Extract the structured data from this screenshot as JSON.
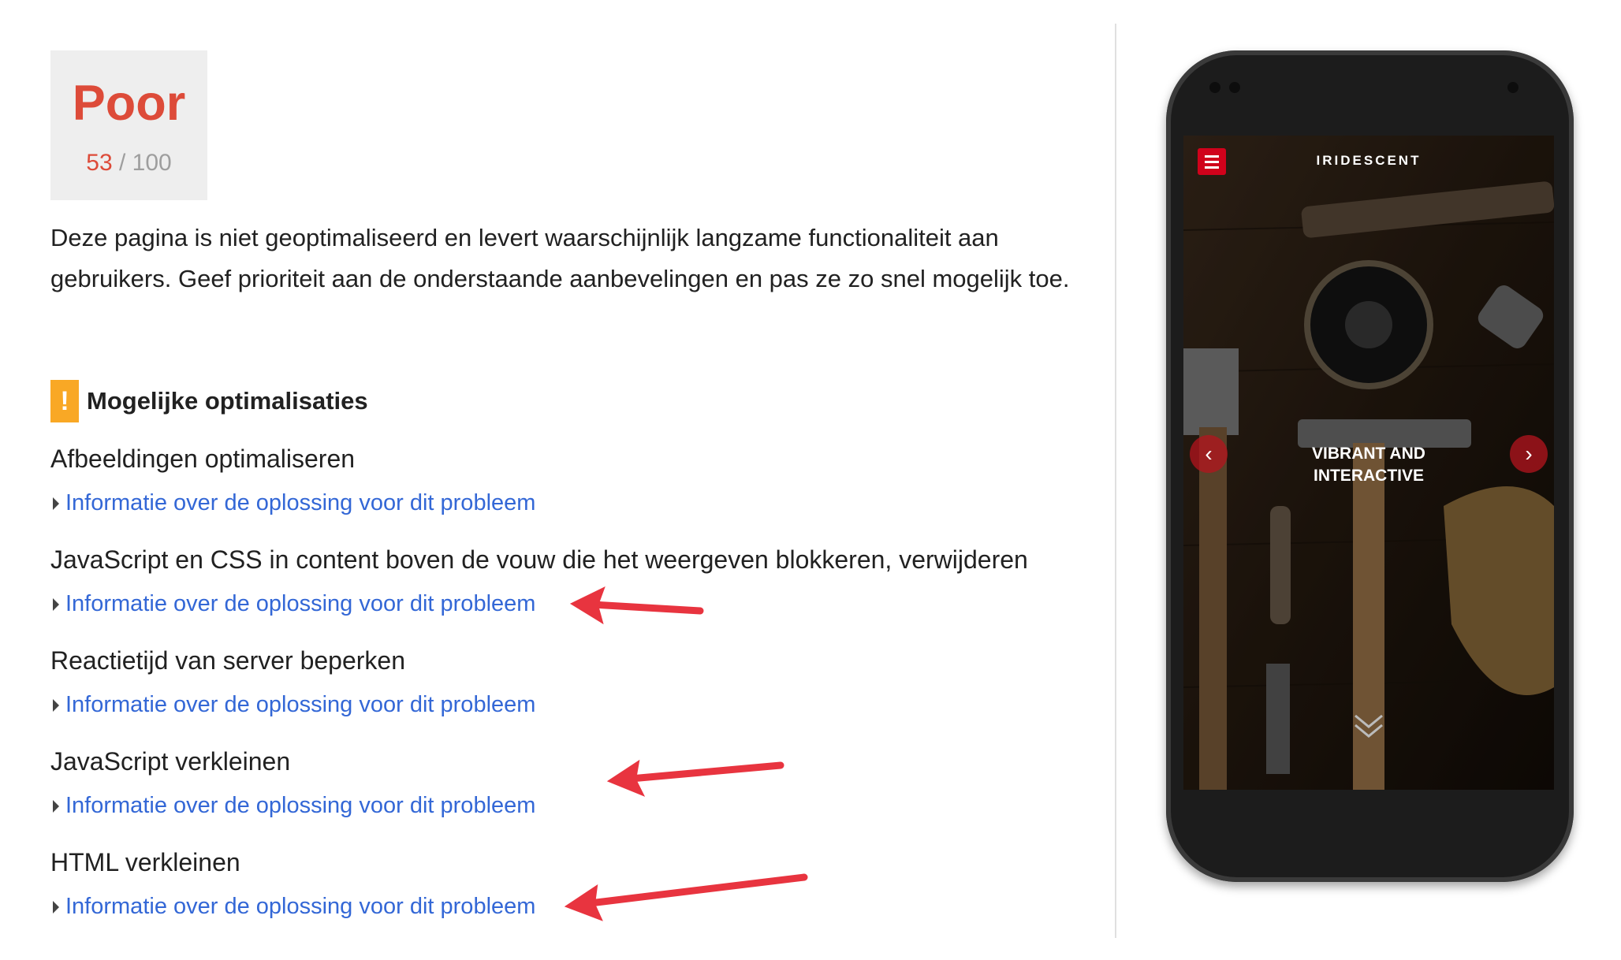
{
  "score": {
    "label": "Poor",
    "value": "53",
    "max": "/ 100",
    "value_color": "#dd4b39"
  },
  "summary": "Deze pagina is niet geoptimaliseerd en levert waarschijnlijk langzame functionaliteit aan gebruikers. Geef prioriteit aan de onderstaande aanbevelingen en pas ze zo snel mogelijk toe.",
  "section": {
    "icon": "warning-icon",
    "icon_glyph": "!",
    "title": "Mogelijke optimalisaties"
  },
  "rules": [
    {
      "title": "Afbeeldingen optimaliseren",
      "link": "Informatie over de oplossing voor dit probleem"
    },
    {
      "title": "JavaScript en CSS in content boven de vouw die het weergeven blokkeren, verwijderen",
      "link": "Informatie over de oplossing voor dit probleem"
    },
    {
      "title": "Reactietijd van server beperken",
      "link": "Informatie over de oplossing voor dit probleem"
    },
    {
      "title": "JavaScript verkleinen",
      "link": "Informatie over de oplossing voor dit probleem"
    },
    {
      "title": "HTML verkleinen",
      "link": "Informatie over de oplossing voor dit probleem"
    }
  ],
  "phone_preview": {
    "brand": "IRIDESCENT",
    "hero_line1": "VIBRANT AND",
    "hero_line2": "INTERACTIVE",
    "prev_glyph": "‹",
    "next_glyph": "›"
  },
  "colors": {
    "link": "#3367d6",
    "warning": "#f9a825",
    "annotation_arrow": "#e8343f"
  }
}
